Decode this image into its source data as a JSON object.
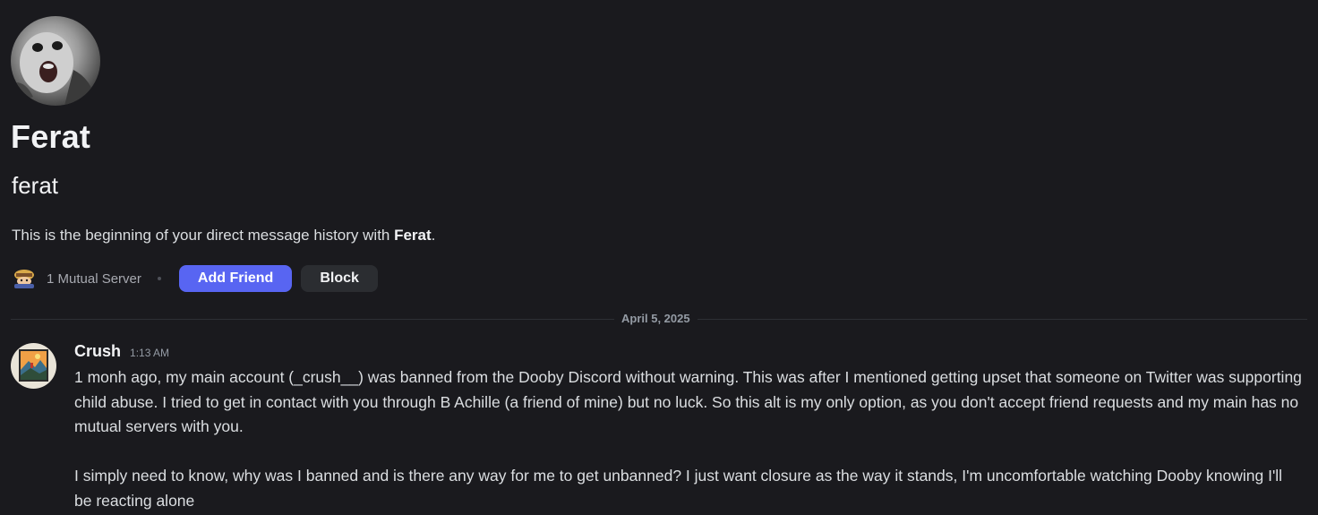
{
  "profile": {
    "display_name": "Ferat",
    "username": "ferat",
    "intro_prefix": "This is the beginning of your direct message history with ",
    "intro_name": "Ferat",
    "intro_suffix": ".",
    "avatar_icon": "ferret-avatar-icon"
  },
  "actions": {
    "mutual_servers": "1 Mutual Server",
    "server_icon": "server-icon",
    "add_friend_label": "Add Friend",
    "block_label": "Block",
    "accent_color": "#5865f2"
  },
  "divider": {
    "date": "April 5, 2025"
  },
  "messages": [
    {
      "author": "Crush",
      "timestamp": "1:13 AM",
      "avatar_icon": "crush-avatar-icon",
      "paragraph_1": "1 monh ago, my main account (_crush__) was banned from the Dooby Discord without warning. This was after I mentioned getting upset that someone on Twitter was supporting child abuse. I tried to get in contact with you through B Achille (a friend of mine) but no luck. So this alt is my only option, as you don't accept friend requests and my main has no mutual servers with you.",
      "paragraph_2": "I simply need to know, why was I banned and is there any way for me to get unbanned? I just want closure as the way it stands, I'm uncomfortable watching Dooby knowing I'll be reacting alone"
    }
  ]
}
